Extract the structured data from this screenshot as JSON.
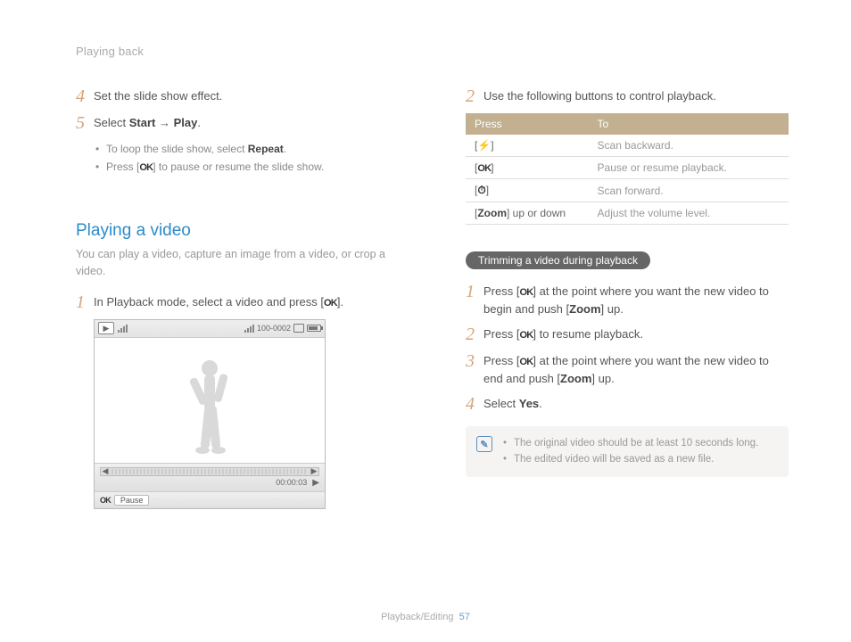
{
  "header": {
    "breadcrumb": "Playing back"
  },
  "left": {
    "step4": {
      "num": "4",
      "text": "Set the slide show effect."
    },
    "step5": {
      "num": "5",
      "prefix": "Select ",
      "start": "Start",
      "arrow": " → ",
      "play": "Play",
      "suffix": "."
    },
    "bullets": {
      "b1_pre": "To loop the slide show, select ",
      "b1_bold": "Repeat",
      "b1_post": ".",
      "b2_pre": "Press [",
      "b2_ok": "OK",
      "b2_post": "] to pause or resume the slide show."
    },
    "section": {
      "title": "Playing a video",
      "desc": "You can play a video, capture an image from a video, or crop a video."
    },
    "vstep1": {
      "num": "1",
      "pre": "In Playback mode, select a video and press [",
      "ok": "OK",
      "post": "]."
    },
    "video": {
      "file_id": "100-0002",
      "timecode": "00:00:03",
      "bottom_ok": "OK",
      "bottom_label": "Pause"
    }
  },
  "right": {
    "step2": {
      "num": "2",
      "text": "Use the following buttons to control playback."
    },
    "table": {
      "h1": "Press",
      "h2": "To",
      "r1k_pre": "[",
      "r1k_icon": "⚡",
      "r1k_post": "]",
      "r1v": "Scan backward.",
      "r2k_pre": "[",
      "r2k_ok": "OK",
      "r2k_post": "]",
      "r2v": "Pause or resume playback.",
      "r3k_pre": "[",
      "r3k_icon": "⏱",
      "r3k_post": "]",
      "r3v": "Scan forward.",
      "r4k_pre": "[",
      "r4k_bold": "Zoom",
      "r4k_post": "] up or down",
      "r4v": "Adjust the volume level."
    },
    "pill": "Trimming a video during playback",
    "t1": {
      "num": "1",
      "pre": "Press [",
      "ok": "OK",
      "mid": "] at the point where you want the new video to begin and push [",
      "zoom": "Zoom",
      "post": "] up."
    },
    "t2": {
      "num": "2",
      "pre": "Press [",
      "ok": "OK",
      "post": "] to resume playback."
    },
    "t3": {
      "num": "3",
      "pre": "Press [",
      "ok": "OK",
      "mid": "] at the point where you want the new video to end and push [",
      "zoom": "Zoom",
      "post": "] up."
    },
    "t4": {
      "num": "4",
      "pre": "Select ",
      "yes": "Yes",
      "post": "."
    },
    "note": {
      "n1": "The original video should be at least 10 seconds long.",
      "n2": "The edited video will be saved as a new file."
    }
  },
  "footer": {
    "section": "Playback/Editing",
    "page": "57"
  }
}
